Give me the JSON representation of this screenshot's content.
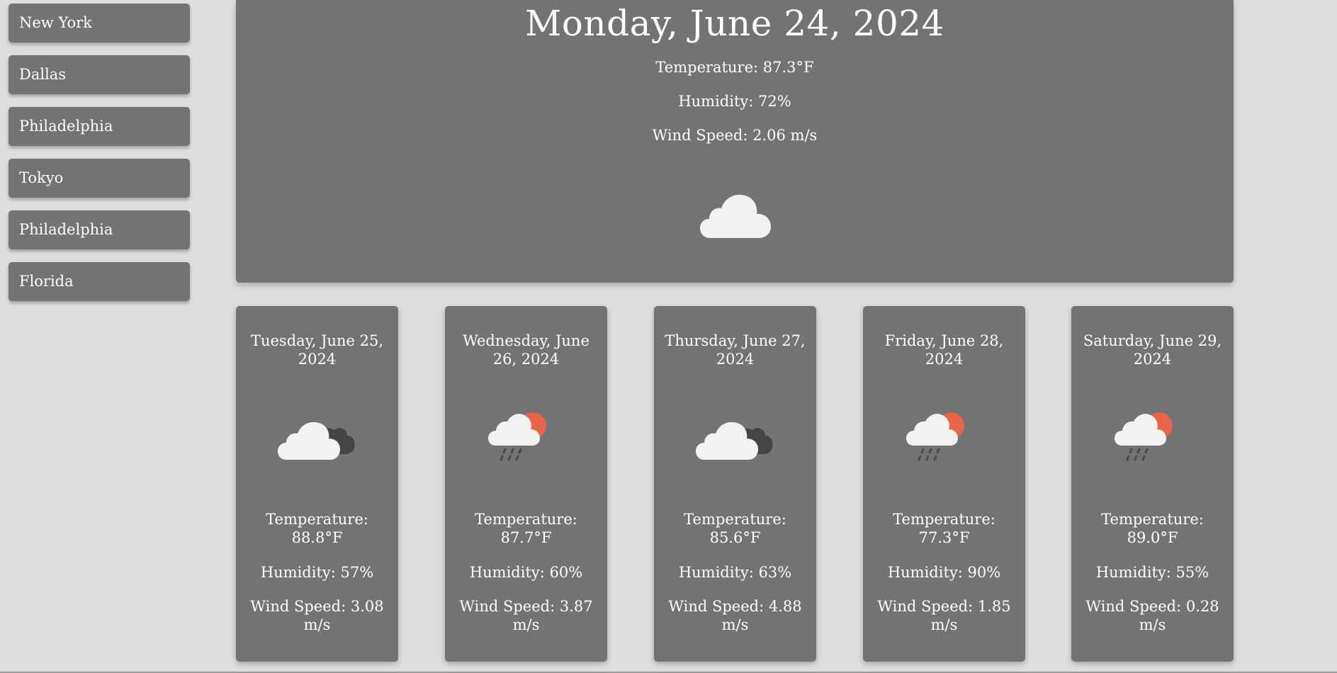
{
  "sidebar": {
    "cities": [
      "New York",
      "Dallas",
      "Philadelphia",
      "Tokyo",
      "Philadelphia",
      "Florida"
    ]
  },
  "current": {
    "date": "Monday, June 24, 2024",
    "temperature": "Temperature: 87.3°F",
    "humidity": "Humidity: 72%",
    "wind": "Wind Speed: 2.06 m/s",
    "icon": "cloud-icon"
  },
  "forecast": [
    {
      "date": "Tuesday, June 25, 2024",
      "temperature": "Temperature: 88.8°F",
      "humidity": "Humidity: 57%",
      "wind": "Wind Speed: 3.08 m/s",
      "icon": "broken-clouds-icon"
    },
    {
      "date": "Wednesday, June 26, 2024",
      "temperature": "Temperature: 87.7°F",
      "humidity": "Humidity: 60%",
      "wind": "Wind Speed: 3.87 m/s",
      "icon": "sun-rain-icon"
    },
    {
      "date": "Thursday, June 27, 2024",
      "temperature": "Temperature: 85.6°F",
      "humidity": "Humidity: 63%",
      "wind": "Wind Speed: 4.88 m/s",
      "icon": "broken-clouds-icon"
    },
    {
      "date": "Friday, June 28, 2024",
      "temperature": "Temperature: 77.3°F",
      "humidity": "Humidity: 90%",
      "wind": "Wind Speed: 1.85 m/s",
      "icon": "sun-rain-icon"
    },
    {
      "date": "Saturday, June 29, 2024",
      "temperature": "Temperature: 89.0°F",
      "humidity": "Humidity: 55%",
      "wind": "Wind Speed: 0.28 m/s",
      "icon": "sun-rain-icon"
    }
  ],
  "colors": {
    "background": "#dedede",
    "card": "#737373",
    "text": "#ffffff",
    "cloud_light": "#f2f2f0",
    "cloud_dark": "#444444",
    "sun": "#e8654a",
    "rain": "#4a4a4a"
  }
}
